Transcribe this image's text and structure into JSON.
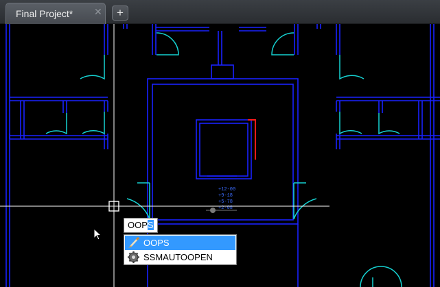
{
  "tabs": [
    {
      "title": "Final Project*",
      "active": true
    }
  ],
  "tab_controls": {
    "close_symbol": "✕",
    "new_tab_symbol": "+"
  },
  "command_line": {
    "typed": "OOP",
    "highlighted_suffix": "S"
  },
  "autocomplete": [
    {
      "label": "OOPS",
      "icon": "brush-icon",
      "selected": true
    },
    {
      "label": "SSMAUTOOPEN",
      "icon": "gear-icon",
      "selected": false
    }
  ],
  "drawing": {
    "elevation_labels": [
      "+12-00",
      "+9-18",
      "+5-78",
      "+2-08"
    ]
  },
  "colors": {
    "background": "#000000",
    "walls": "#1a22ff",
    "doors": "#16d2d2",
    "crosshair": "#ffffff",
    "red_line": "#ff1a1a",
    "highlight": "#3399ff"
  }
}
